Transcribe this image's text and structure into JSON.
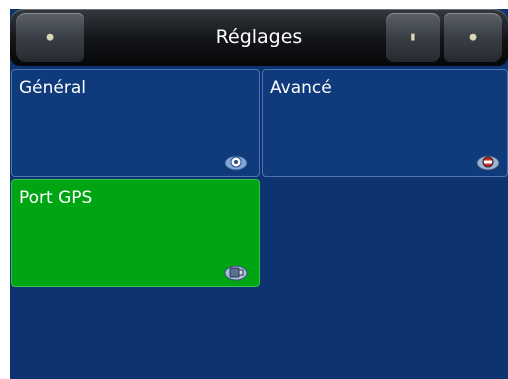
{
  "header": {
    "title": "Réglages",
    "back_icon": "back-icon",
    "left_icon": "menu-icon",
    "right_icon": "close-icon"
  },
  "tiles": [
    {
      "label": "Général",
      "icon": "general-settings-icon",
      "active": false
    },
    {
      "label": "Avancé",
      "icon": "advanced-settings-icon",
      "active": false
    },
    {
      "label": "Port GPS",
      "icon": "gps-port-icon",
      "active": true
    }
  ],
  "colors": {
    "background": "#0d3470",
    "tile": "#0f3a7c",
    "tile_active": "#00a513",
    "titlebar": "#121417"
  }
}
